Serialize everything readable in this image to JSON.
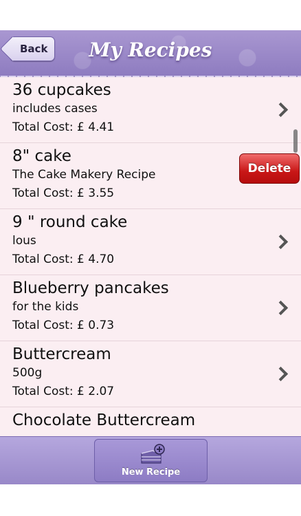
{
  "navbar": {
    "back_label": "Back",
    "title": "My Recipes"
  },
  "recipes": [
    {
      "title": "36 cupcakes",
      "subtitle": "includes cases",
      "cost": "Total Cost: £ 4.41"
    },
    {
      "title": "8\" cake",
      "subtitle": "The Cake Makery Recipe",
      "cost": "Total Cost: £ 3.55"
    },
    {
      "title": "9 \" round cake",
      "subtitle": "lous",
      "cost": "Total Cost: £ 4.70"
    },
    {
      "title": "Blueberry pancakes",
      "subtitle": "for the kids",
      "cost": "Total Cost: £ 0.73"
    },
    {
      "title": "Buttercream",
      "subtitle": "500g",
      "cost": "Total Cost: £ 2.07"
    },
    {
      "title": "Chocolate Buttercream",
      "subtitle": "",
      "cost": ""
    }
  ],
  "delete_label": "Delete",
  "toolbar": {
    "new_recipe_label": "New Recipe",
    "icon": "cake-add-icon"
  },
  "colors": {
    "accent": "#9a89c9",
    "list_bg": "#fbeef2",
    "delete": "#c91717"
  }
}
